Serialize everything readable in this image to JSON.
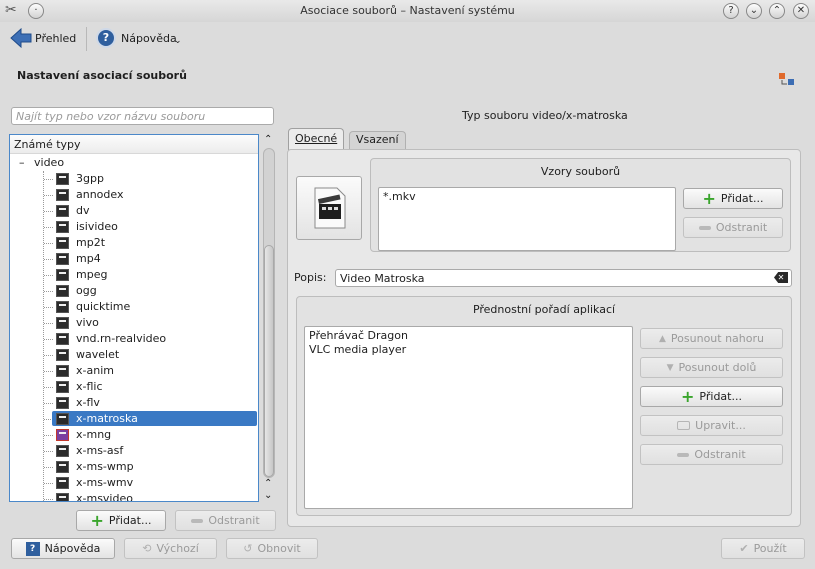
{
  "window": {
    "title": "Asociace souborů – Nastavení systému",
    "controls": [
      "?",
      "⌄",
      "⌃",
      "✕"
    ]
  },
  "toolbar": {
    "back_label": "Přehled",
    "help_label": "Nápověda"
  },
  "page": {
    "heading": "Nastavení asociací souborů"
  },
  "search": {
    "placeholder": "Najít typ nebo vzor názvu souboru"
  },
  "tree": {
    "header": "Známé typy",
    "group": "video",
    "items": [
      "3gpp",
      "annodex",
      "dv",
      "isivideo",
      "mp2t",
      "mp4",
      "mpeg",
      "ogg",
      "quicktime",
      "vivo",
      "vnd.rn-realvideo",
      "wavelet",
      "x-anim",
      "x-flic",
      "x-flv",
      "x-matroska",
      "x-mng",
      "x-ms-asf",
      "x-ms-wmp",
      "x-ms-wmv",
      "x-msvideo"
    ],
    "selected": "x-matroska"
  },
  "left_buttons": {
    "add": "Přidat...",
    "remove": "Odstranit"
  },
  "right": {
    "type_title": "Typ souboru video/x-matroska",
    "tabs": [
      "Obecné",
      "Vsazení"
    ],
    "active_tab": "Obecné",
    "patterns": {
      "title": "Vzory souborů",
      "items": [
        "*.mkv"
      ],
      "add": "Přidat...",
      "remove": "Odstranit"
    },
    "description": {
      "label": "Popis:",
      "value": "Video Matroska"
    },
    "apps": {
      "title": "Přednostní pořadí aplikací",
      "items": [
        "Přehrávač Dragon",
        "VLC media player"
      ],
      "move_up": "Posunout nahoru",
      "move_down": "Posunout dolů",
      "add": "Přidat...",
      "edit": "Upravit...",
      "remove": "Odstranit"
    }
  },
  "bottom": {
    "help": "Nápověda",
    "defaults": "Výchozí",
    "reset": "Obnovit",
    "apply": "Použít"
  },
  "colors": {
    "selection": "#3a79c4",
    "focus_border": "#4b88c9",
    "add_green": "#3aa52c"
  }
}
